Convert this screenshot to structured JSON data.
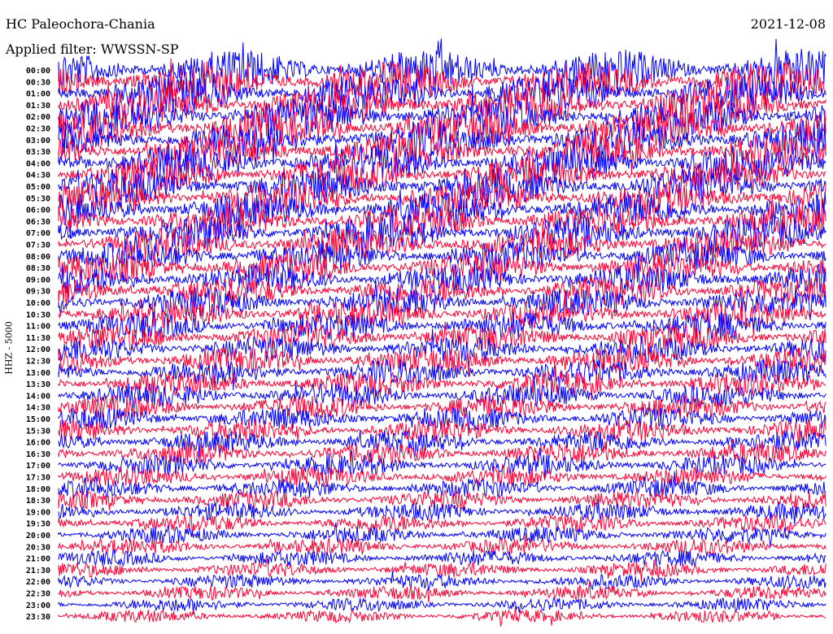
{
  "header": {
    "station": "HC Paleochora-Chania",
    "date": "2021-12-08",
    "filter": "Applied filter: WWSSN-SP"
  },
  "chart_data": {
    "type": "line",
    "title": "HC Paleochora-Chania",
    "date": "2021-12-08",
    "subtitle": "Applied filter: WWSSN-SP",
    "ylabel": "HHZ - 5000",
    "row_labels": [
      "00:00",
      "00:30",
      "01:00",
      "01:30",
      "02:00",
      "02:30",
      "03:00",
      "03:30",
      "04:00",
      "04:30",
      "05:00",
      "05:30",
      "06:00",
      "06:30",
      "07:00",
      "07:30",
      "08:00",
      "08:30",
      "09:00",
      "09:30",
      "10:00",
      "10:30",
      "11:00",
      "11:30",
      "12:00",
      "12:30",
      "13:00",
      "13:30",
      "14:00",
      "14:30",
      "15:00",
      "15:30",
      "16:00",
      "16:30",
      "17:00",
      "17:30",
      "18:00",
      "18:30",
      "19:00",
      "19:30",
      "20:00",
      "20:30",
      "21:00",
      "21:30",
      "22:00",
      "22:30",
      "23:00",
      "23:30"
    ],
    "trace_colors": [
      "#0000ff",
      "#ff0033"
    ],
    "grid": false,
    "legend": "none"
  }
}
